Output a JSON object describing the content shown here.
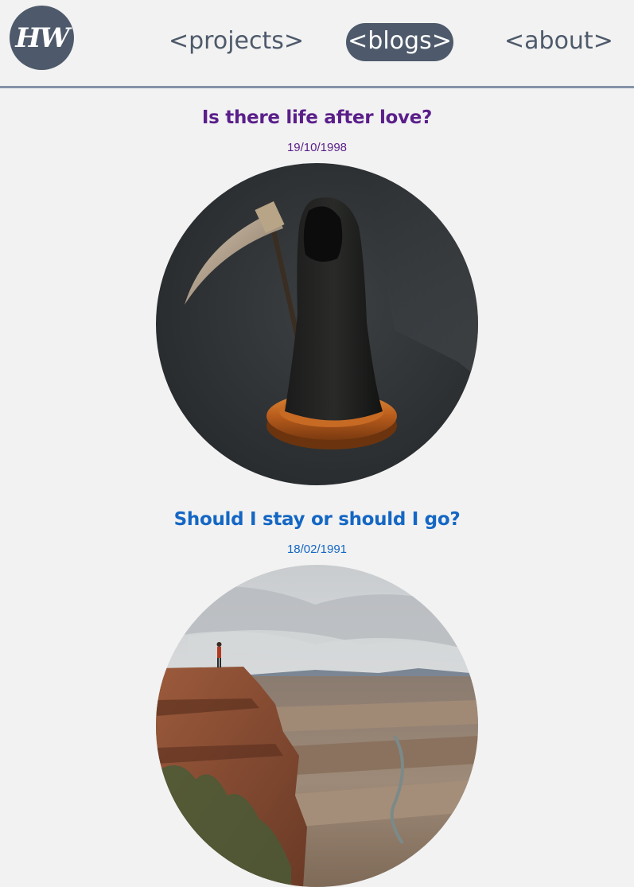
{
  "header": {
    "logo_text": "HW",
    "nav": [
      {
        "label": "<projects>",
        "active": false
      },
      {
        "label": "<blogs>",
        "active": true
      },
      {
        "label": "<about>",
        "active": false
      }
    ]
  },
  "posts": [
    {
      "title": "Is there life after love?",
      "date": "19/10/1998",
      "image_icon": "grim-reaper-figurine-icon",
      "color": "#5a1f8a"
    },
    {
      "title": "Should I stay or should I go?",
      "date": "18/02/1991",
      "image_icon": "canyon-cliff-icon",
      "color": "#1467c4"
    }
  ],
  "colors": {
    "background": "#f2f2f2",
    "brand": "#4e5a6b",
    "divider": "#8593a8"
  }
}
